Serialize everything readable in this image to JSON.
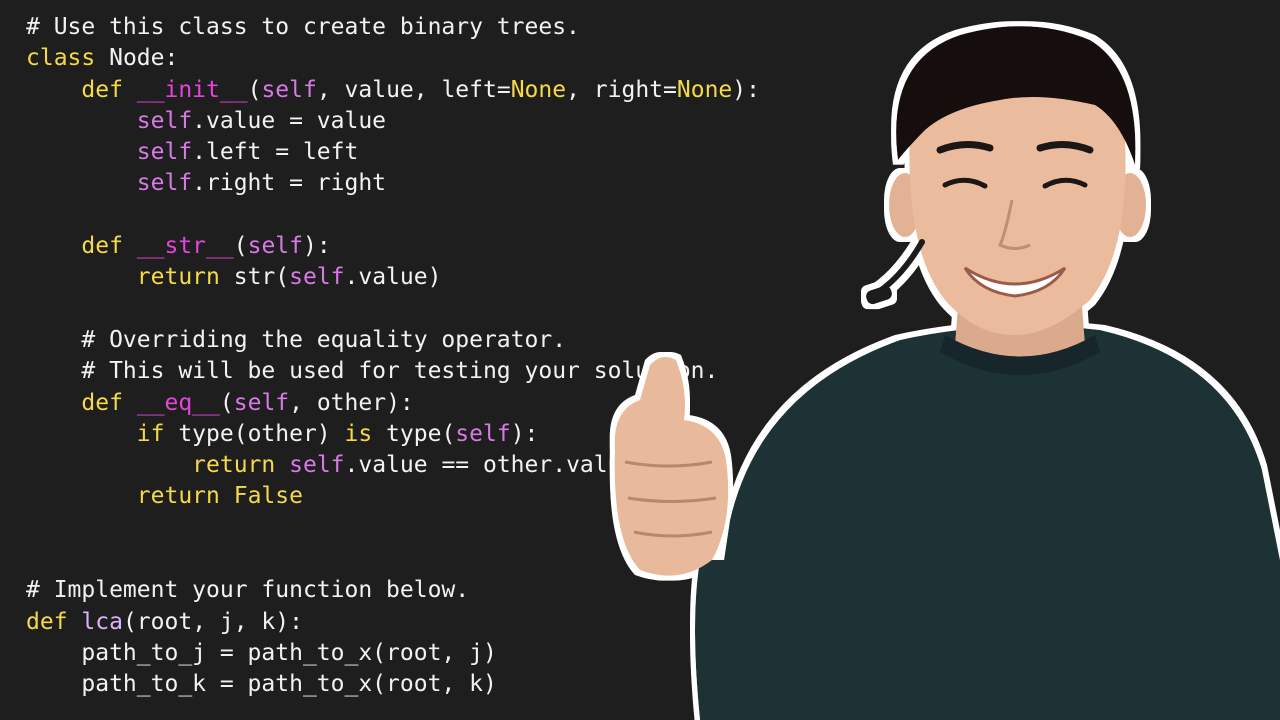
{
  "code": {
    "lines": [
      [
        [
          "cmt",
          "# Use this class to create binary trees."
        ]
      ],
      [
        [
          "kw",
          "class"
        ],
        [
          "txt",
          " Node:"
        ]
      ],
      [
        [
          "txt",
          "    "
        ],
        [
          "kw",
          "def"
        ],
        [
          "txt",
          " "
        ],
        [
          "dun",
          "__init__"
        ],
        [
          "txt",
          "("
        ],
        [
          "self",
          "self"
        ],
        [
          "txt",
          ", value, left="
        ],
        [
          "kw",
          "None"
        ],
        [
          "txt",
          ", right="
        ],
        [
          "kw",
          "None"
        ],
        [
          "txt",
          "):"
        ]
      ],
      [
        [
          "txt",
          "        "
        ],
        [
          "self",
          "self"
        ],
        [
          "txt",
          ".value = value"
        ]
      ],
      [
        [
          "txt",
          "        "
        ],
        [
          "self",
          "self"
        ],
        [
          "txt",
          ".left = left"
        ]
      ],
      [
        [
          "txt",
          "        "
        ],
        [
          "self",
          "self"
        ],
        [
          "txt",
          ".right = right"
        ]
      ],
      [],
      [
        [
          "txt",
          "    "
        ],
        [
          "kw",
          "def"
        ],
        [
          "txt",
          " "
        ],
        [
          "dun",
          "__str__"
        ],
        [
          "txt",
          "("
        ],
        [
          "self",
          "self"
        ],
        [
          "txt",
          "):"
        ]
      ],
      [
        [
          "txt",
          "        "
        ],
        [
          "kw",
          "return"
        ],
        [
          "txt",
          " str("
        ],
        [
          "self",
          "self"
        ],
        [
          "txt",
          ".value)"
        ]
      ],
      [],
      [
        [
          "txt",
          "    "
        ],
        [
          "cmt",
          "# Overriding the equality operator."
        ]
      ],
      [
        [
          "txt",
          "    "
        ],
        [
          "cmt",
          "# This will be used for testing your solution."
        ]
      ],
      [
        [
          "txt",
          "    "
        ],
        [
          "kw",
          "def"
        ],
        [
          "txt",
          " "
        ],
        [
          "dun",
          "__eq__"
        ],
        [
          "txt",
          "("
        ],
        [
          "self",
          "self"
        ],
        [
          "txt",
          ", other):"
        ]
      ],
      [
        [
          "txt",
          "        "
        ],
        [
          "kw",
          "if"
        ],
        [
          "txt",
          " type(other) "
        ],
        [
          "kw",
          "is"
        ],
        [
          "txt",
          " type("
        ],
        [
          "self",
          "self"
        ],
        [
          "txt",
          "):"
        ]
      ],
      [
        [
          "txt",
          "            "
        ],
        [
          "kw",
          "return"
        ],
        [
          "txt",
          " "
        ],
        [
          "self",
          "self"
        ],
        [
          "txt",
          ".value == other.value"
        ]
      ],
      [
        [
          "txt",
          "        "
        ],
        [
          "kw",
          "return"
        ],
        [
          "txt",
          " "
        ],
        [
          "kw",
          "False"
        ]
      ],
      [],
      [],
      [
        [
          "cmt",
          "# Implement your function below."
        ]
      ],
      [
        [
          "kw",
          "def"
        ],
        [
          "txt",
          " "
        ],
        [
          "fn",
          "lca"
        ],
        [
          "txt",
          "(root, j, k):"
        ]
      ],
      [
        [
          "txt",
          "    path_to_j = path_to_x(root, j)"
        ]
      ],
      [
        [
          "txt",
          "    path_to_k = path_to_x(root, k)"
        ]
      ]
    ]
  },
  "colors": {
    "background": "#1e1e1e",
    "keyword": "#f5d94a",
    "dunder": "#e544d8",
    "self": "#d87ae6",
    "text": "#f2f2f2",
    "sweater": "#1b3236",
    "skin": "#e8b99a",
    "hair": "#141010"
  },
  "person": {
    "icon": "presenter-thumbs-up-illustration"
  }
}
